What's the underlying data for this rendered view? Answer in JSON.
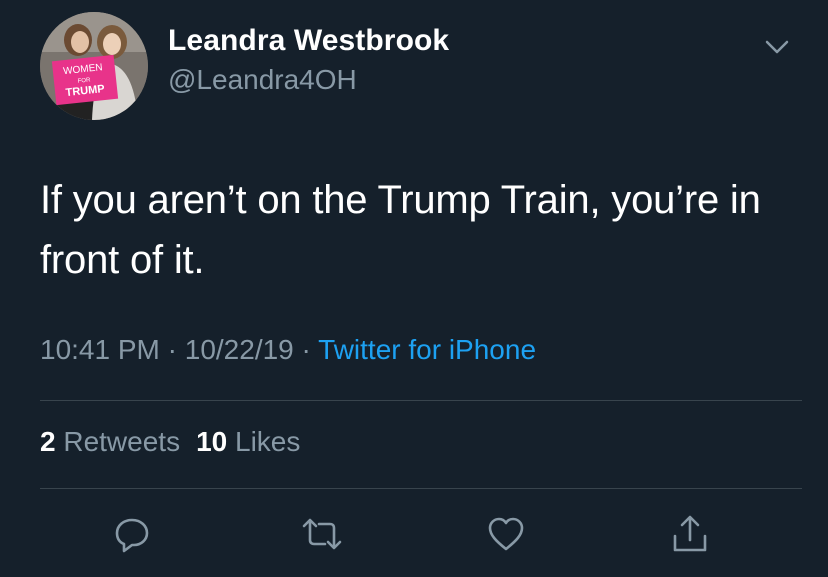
{
  "user": {
    "display_name": "Leandra Westbrook",
    "handle": "@Leandra4OH",
    "avatar_sign_lines": [
      "WOMEN",
      "FOR",
      "TRUMP"
    ]
  },
  "tweet": {
    "text": "If you aren’t on the Trump Train, you’re in front of it.",
    "time": "10:41 PM",
    "date": "10/22/19",
    "separator": " · ",
    "source": "Twitter for iPhone"
  },
  "stats": {
    "retweets_count": "2",
    "retweets_label": "Retweets",
    "likes_count": "10",
    "likes_label": "Likes"
  },
  "colors": {
    "background": "#15202b",
    "text_primary": "#ffffff",
    "text_secondary": "#8899a6",
    "accent": "#1da1f2",
    "divider": "#38444d"
  },
  "icons": {
    "menu": "chevron-down-icon",
    "reply": "reply-icon",
    "retweet": "retweet-icon",
    "like": "heart-icon",
    "share": "share-icon"
  }
}
